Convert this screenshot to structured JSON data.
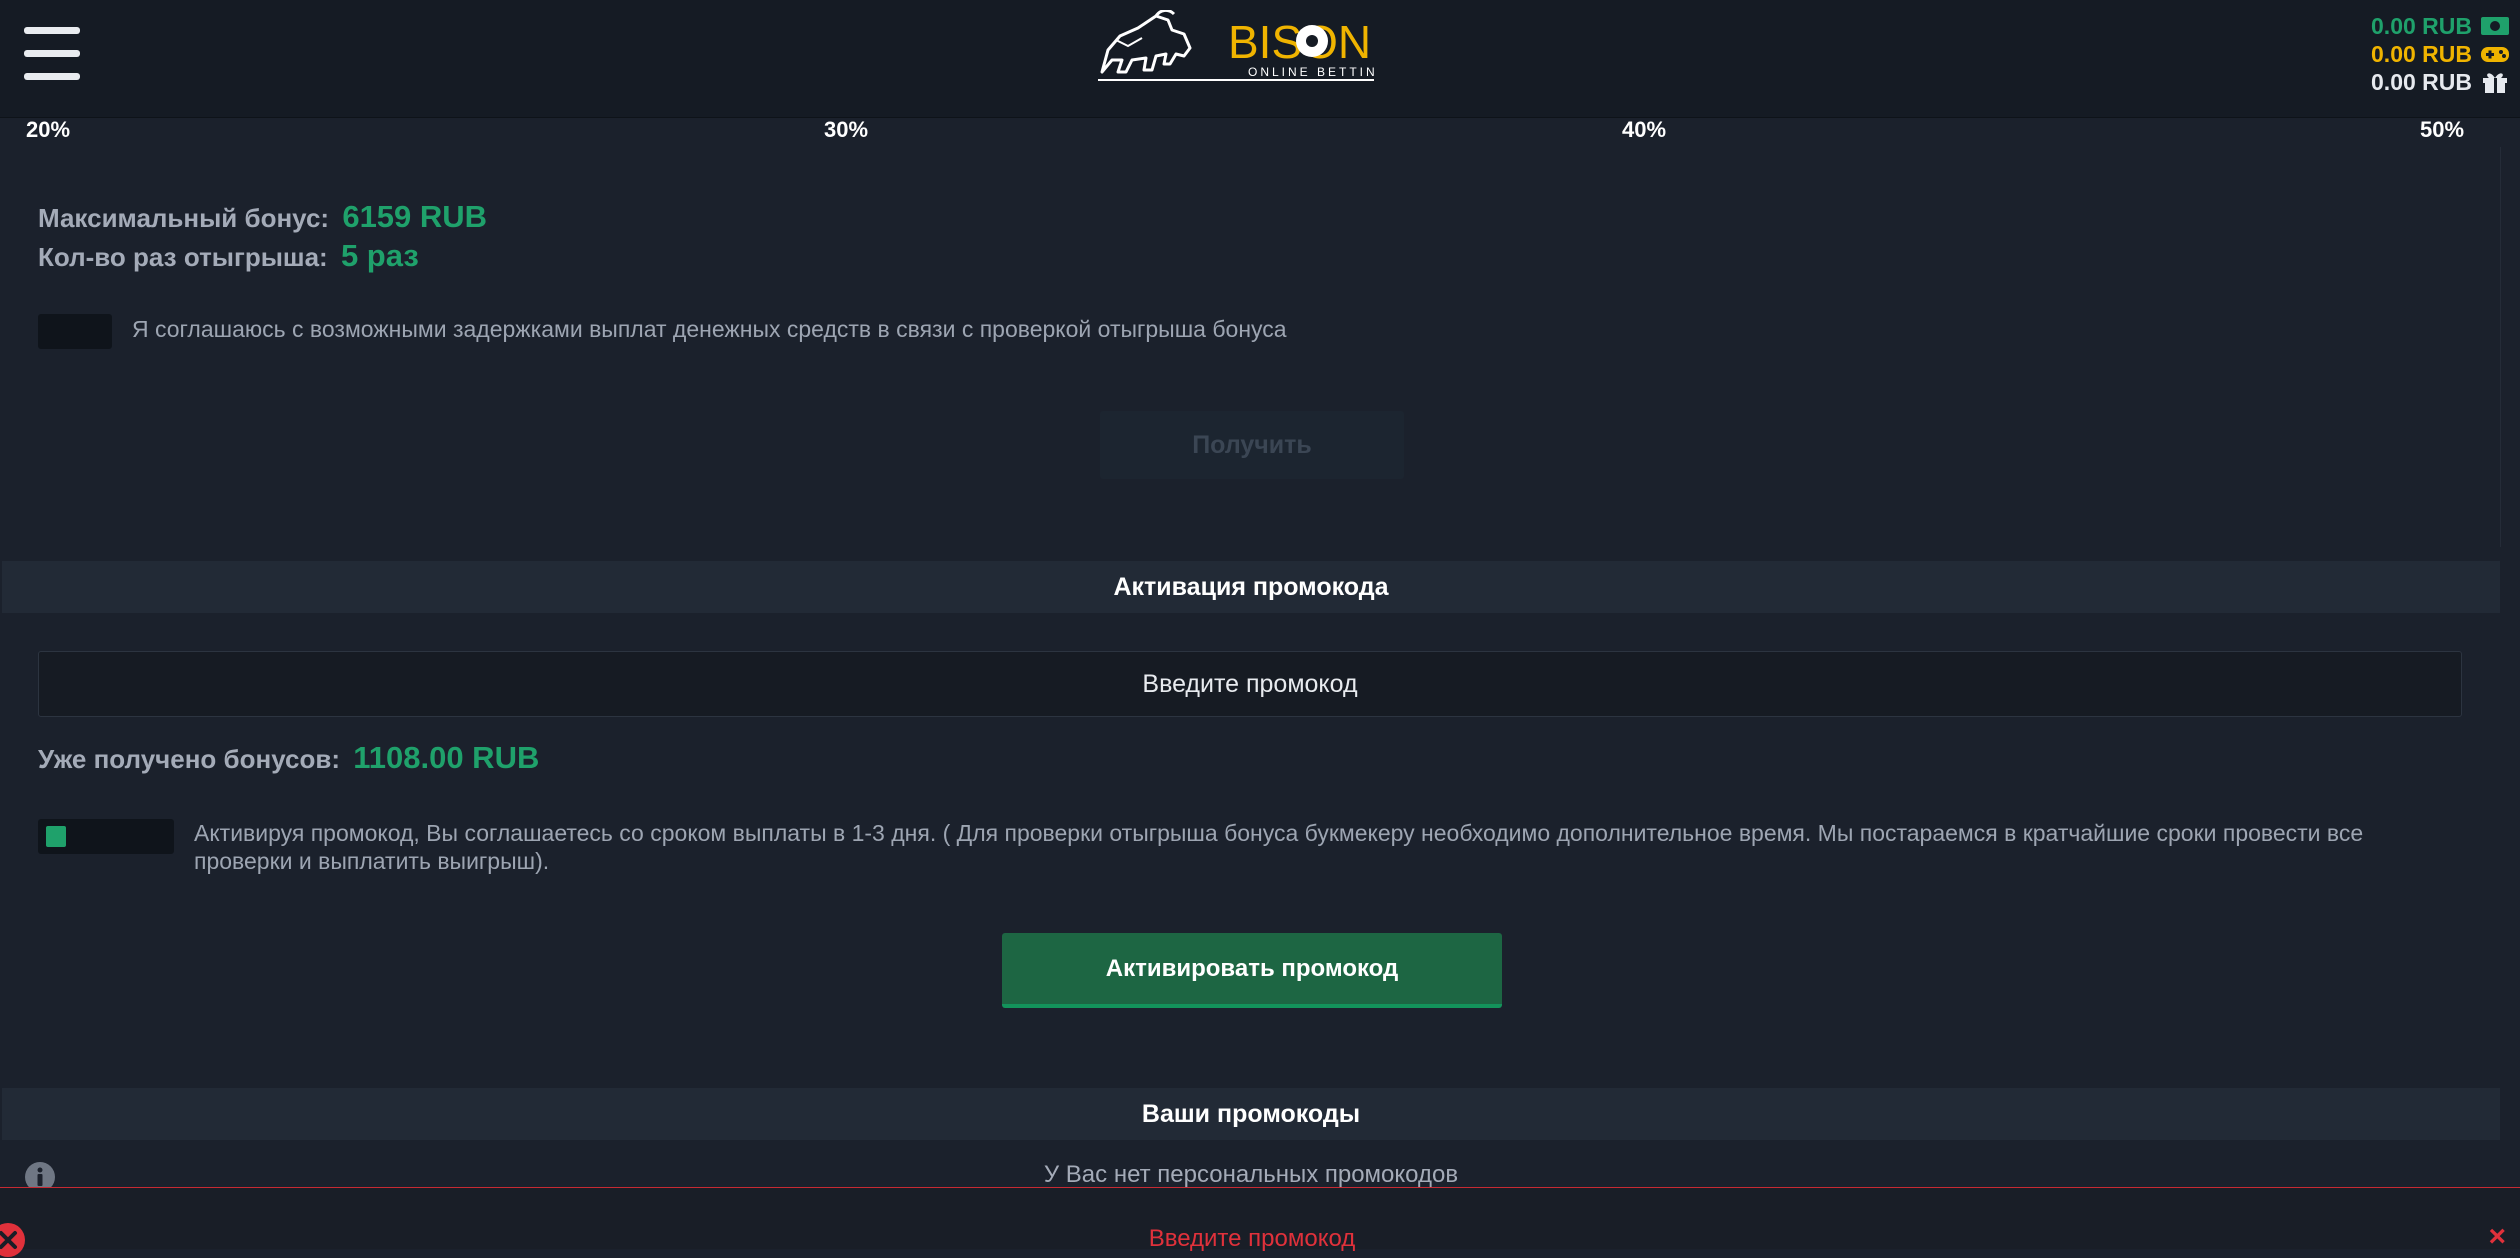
{
  "header": {
    "menu_icon": "hamburger-menu-icon",
    "logo": {
      "brand": "BISON",
      "tagline": "ONLINE BETTING"
    },
    "balances": [
      {
        "value": "0.00 RUB",
        "icon": "money-icon",
        "color": "#1fa16b"
      },
      {
        "value": "0.00 RUB",
        "icon": "gamepad-icon",
        "color": "#f0b400"
      },
      {
        "value": "0.00 RUB",
        "icon": "gift-icon",
        "color": "#e6e9ee"
      }
    ]
  },
  "scale": {
    "ticks": [
      "20%",
      "30%",
      "40%",
      "50%"
    ]
  },
  "bonus": {
    "max_label": "Максимальный бонус:",
    "max_value": "6159 RUB",
    "wager_label": "Кол-во раз отыгрыша:",
    "wager_value": "5 раз",
    "agree_text": "Я соглашаюсь с возможными задержками выплат денежных средств в связи с проверкой отыгрыша бонуса",
    "agree_checked": false,
    "get_button": "Получить"
  },
  "promo": {
    "title": "Активация промокода",
    "input_placeholder": "Введите промокод",
    "received_label": "Уже получено бонусов:",
    "received_value": "1108.00 RUB",
    "terms_text": "Активируя промокод, Вы соглашаетесь со сроком выплаты в 1-3 дня. ( Для проверки отыгрыша бонуса букмекеру необходимо дополнительное время. Мы постараемся в кратчайшие сроки провести все проверки и выплатить выигрыш).",
    "terms_checked": true,
    "activate_button": "Активировать промокод"
  },
  "my_codes": {
    "title": "Ваши промокоды",
    "info_icon": "info-icon",
    "empty_text": "У Вас нет персональных промокодов"
  },
  "toast": {
    "message": "Введите промокод",
    "close": "×",
    "icon": "error-icon"
  },
  "colors": {
    "accent_green": "#1fa16b",
    "gold": "#f0b400",
    "error_red": "#e0313b",
    "background": "#1b212c"
  }
}
